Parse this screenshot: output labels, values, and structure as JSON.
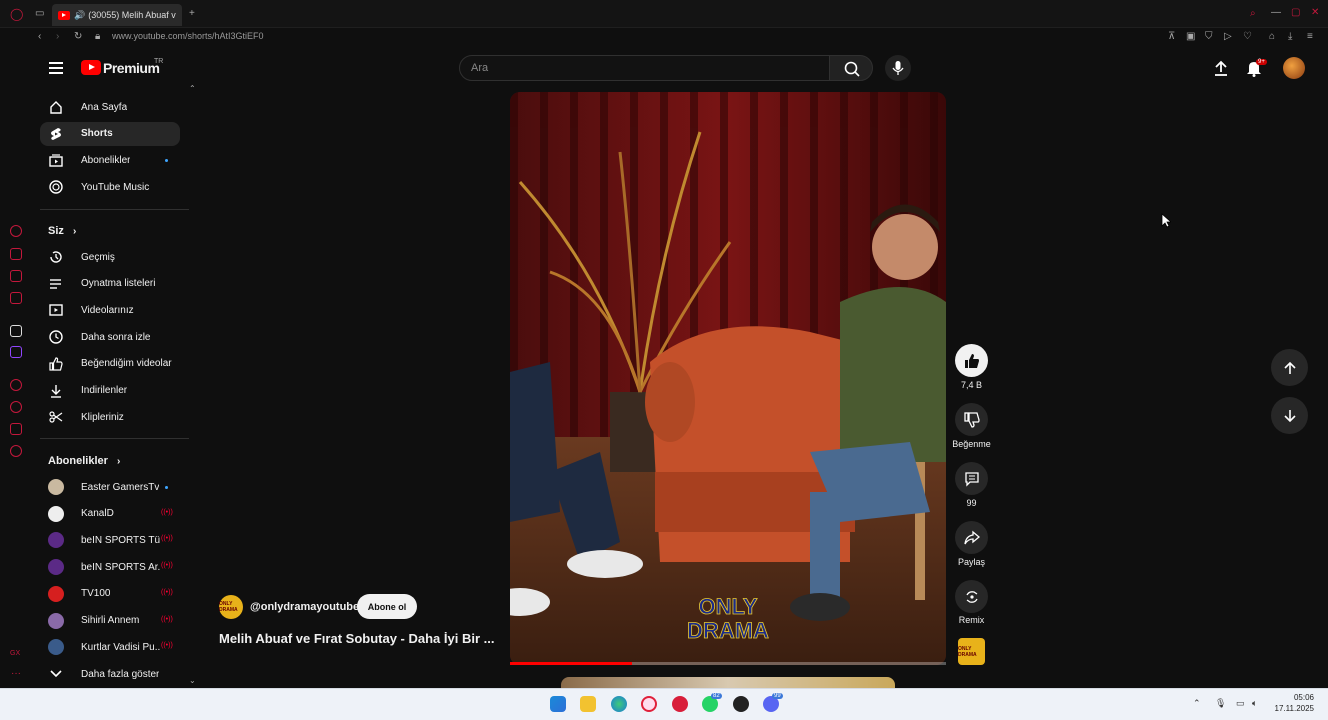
{
  "browser": {
    "tab_title": "(30055) Melih Abuaf v",
    "url": "www.youtube.com/shorts/hAtI3GtiEF0"
  },
  "masthead": {
    "logo_text": "Premium",
    "logo_region": "TR",
    "search_placeholder": "Ara",
    "notification_badge": "9+"
  },
  "sidebar": {
    "main": [
      {
        "label": "Ana Sayfa",
        "icon": "home-icon"
      },
      {
        "label": "Shorts",
        "icon": "shorts-icon",
        "active": true
      },
      {
        "label": "Abonelikler",
        "icon": "subscriptions-icon",
        "dot": true
      },
      {
        "label": "YouTube Music",
        "icon": "music-icon"
      }
    ],
    "you_header": "Siz",
    "you": [
      {
        "label": "Geçmiş",
        "icon": "history-icon"
      },
      {
        "label": "Oynatma listeleri",
        "icon": "playlist-icon"
      },
      {
        "label": "Videolarınız",
        "icon": "your-videos-icon"
      },
      {
        "label": "Daha sonra izle",
        "icon": "watch-later-icon"
      },
      {
        "label": "Beğendiğim videolar",
        "icon": "liked-icon"
      },
      {
        "label": "İndirilenler",
        "icon": "download-icon"
      },
      {
        "label": "Klipleriniz",
        "icon": "clips-icon"
      }
    ],
    "subs_header": "Abonelikler",
    "subscriptions": [
      {
        "label": "Easter GamersTv",
        "color": "#c9b9a0",
        "status": "dot"
      },
      {
        "label": "KanalD",
        "color": "#eeeeee",
        "status": "live"
      },
      {
        "label": "beIN SPORTS Tü...",
        "color": "#5b2a86",
        "status": "live"
      },
      {
        "label": "beIN SPORTS Ar...",
        "color": "#5b2a86",
        "status": "live"
      },
      {
        "label": "TV100",
        "color": "#d61f1f",
        "status": "live"
      },
      {
        "label": "Sihirli Annem",
        "color": "#8a6aa8",
        "status": "live"
      },
      {
        "label": "Kurtlar Vadisi Pu...",
        "color": "#3a5b8a",
        "status": "live"
      }
    ],
    "show_more": "Daha fazla göster"
  },
  "short": {
    "channel": "@onlydramayoutube",
    "channel_avatar_text": "ONLY DRAMA",
    "subscribe_label": "Abone ol",
    "title": "Melih Abuaf ve Fırat Sobutay - Daha İyi Bir ...",
    "watermark_line1": "ONLY",
    "watermark_line2": "DRAMA",
    "progress": 0.28
  },
  "actions": {
    "like_count": "7,4 B",
    "dislike_label": "Beğenme",
    "comments_count": "99",
    "share_label": "Paylaş",
    "remix_label": "Remix"
  },
  "taskbar": {
    "time": "05:06",
    "date": "17.11.2025",
    "badge_whatsapp": "82",
    "badge_discord": "99"
  }
}
